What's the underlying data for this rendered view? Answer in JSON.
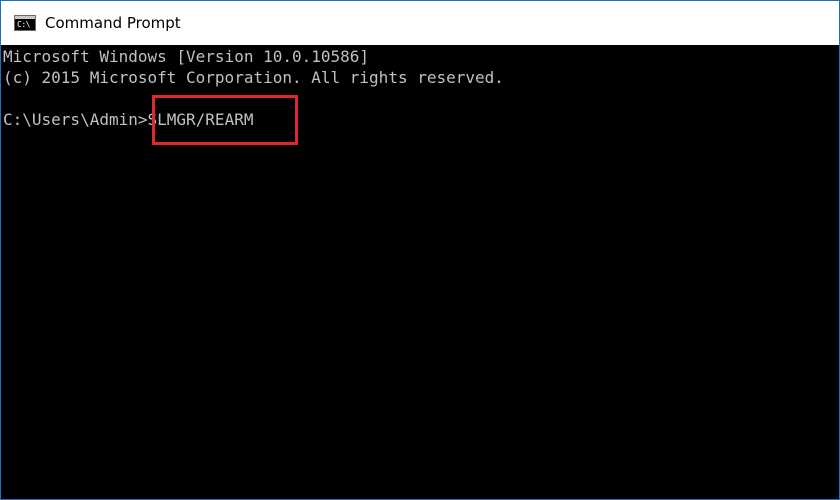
{
  "window": {
    "title": "Command Prompt",
    "icon": "command-prompt-icon",
    "icon_glyph": "C:\\",
    "border_color": "#1f6fbf"
  },
  "console": {
    "background": "#000000",
    "text_color": "#c0c0c0",
    "lines": [
      "Microsoft Windows [Version 10.0.10586]",
      "(c) 2015 Microsoft Corporation. All rights reserved."
    ],
    "prompt": "C:\\Users\\Admin>",
    "command": "SLMGR/REARM"
  },
  "annotation": {
    "highlight_color": "#e0282e"
  }
}
